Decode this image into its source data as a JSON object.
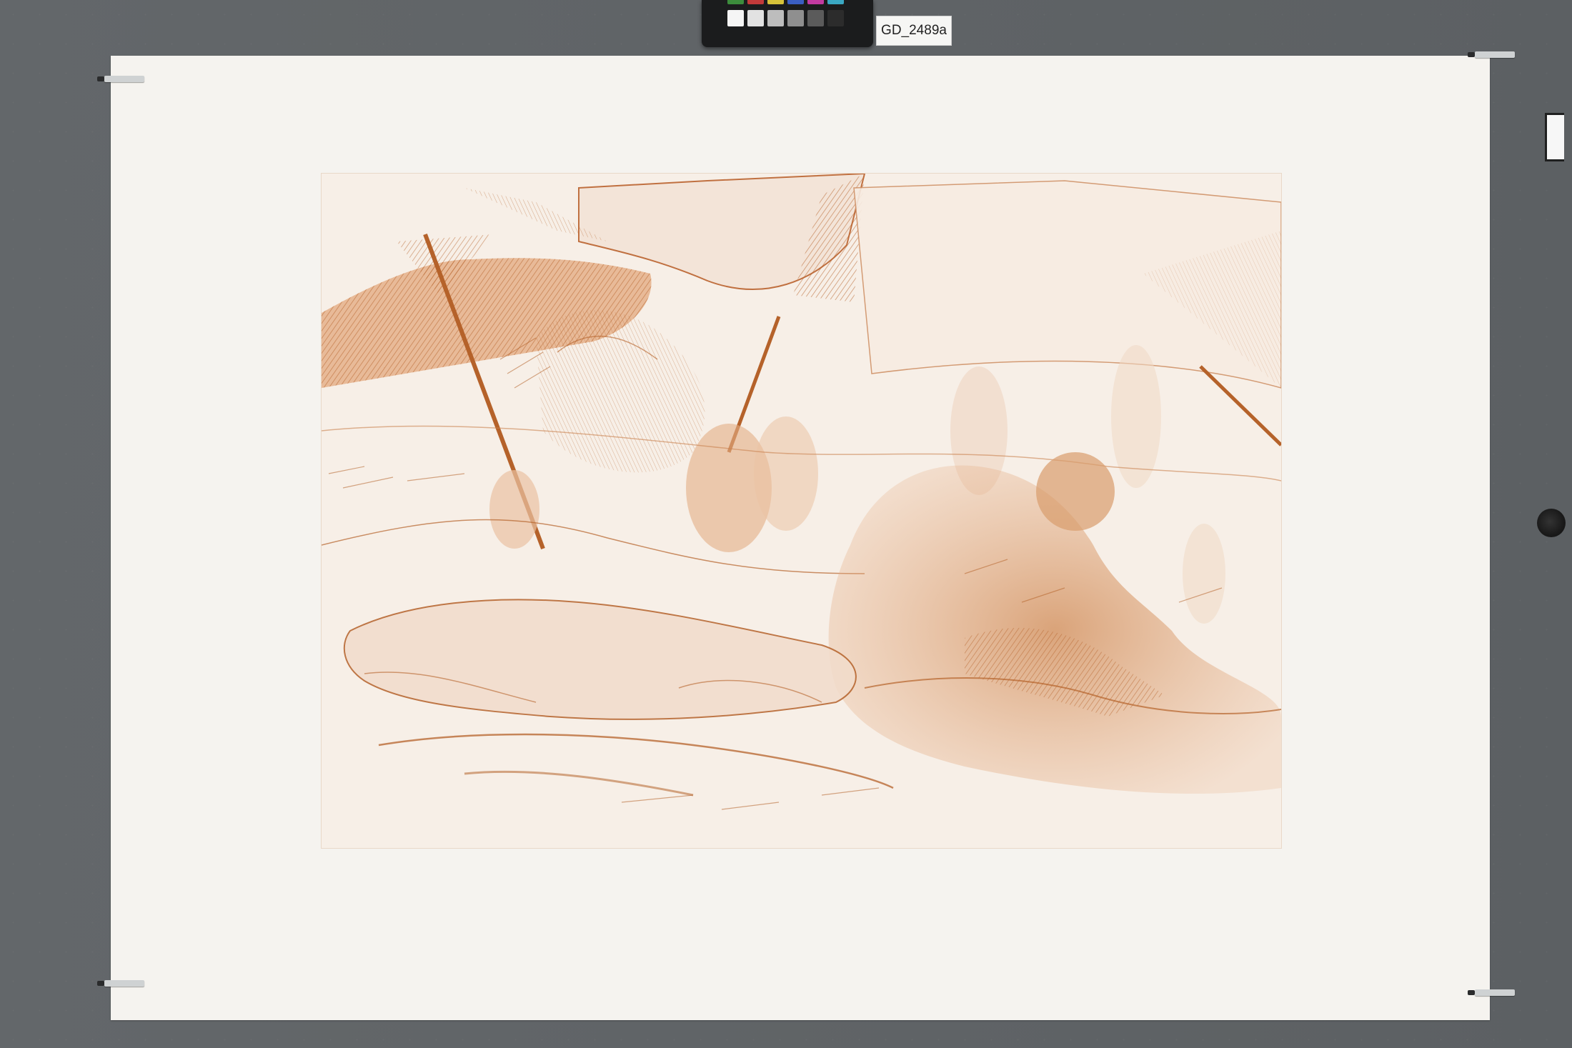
{
  "specimen_id": "GD_2489a",
  "colors": {
    "board": "#606467",
    "sheet": "#f5f3ef",
    "plate_tint": "#f7efe7",
    "ink": "#b5622a"
  },
  "color_checker": {
    "swatches": [
      "#ffffff",
      "#d7d7d7",
      "#a9a9a9",
      "#7d7d7d",
      "#4a4a4a",
      "#1f1f1f",
      "#202020",
      "#9a9a9a"
    ]
  }
}
